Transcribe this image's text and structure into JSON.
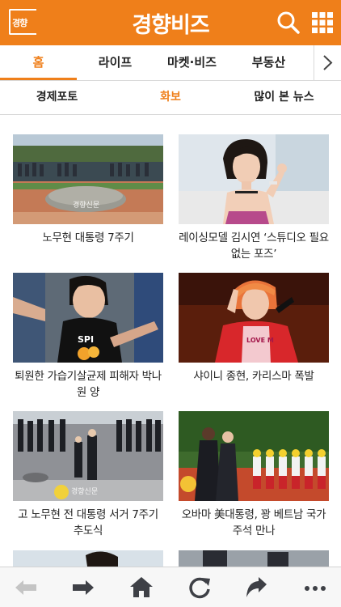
{
  "header": {
    "logo_text": "경향",
    "brand": "경향비즈",
    "icons": [
      "search-icon",
      "grid-menu-icon"
    ],
    "color": "#ef7f1a"
  },
  "tabs_primary": [
    {
      "label": "홈",
      "active": true
    },
    {
      "label": "라이프",
      "active": false
    },
    {
      "label": "마켓·비즈",
      "active": false
    },
    {
      "label": "부동산",
      "active": false
    }
  ],
  "tabs_secondary": [
    {
      "label": "경제포토",
      "active": false
    },
    {
      "label": "화보",
      "active": true
    },
    {
      "label": "많이 본 뉴스",
      "active": false
    }
  ],
  "gallery": [
    {
      "caption": "노무현 대통령 7주기",
      "watermark": "경향신문"
    },
    {
      "caption": "레이싱모델 김시연 ‘스튜디오 필요없는 포즈’"
    },
    {
      "caption": "퇴원한 가습기살균제 피해자 박나원 양"
    },
    {
      "caption": "샤이니 종현, 카리스마 폭발"
    },
    {
      "caption": "고 노무현 전 대통령 서거 7주기 추도식",
      "watermark": "경향신문"
    },
    {
      "caption": "오바마 美대통령, 꽝 베트남 국가주석 만나"
    }
  ],
  "toolbar": {
    "icons": [
      "back-arrow-icon",
      "forward-arrow-icon",
      "home-icon",
      "refresh-icon",
      "share-icon",
      "more-icon"
    ]
  }
}
